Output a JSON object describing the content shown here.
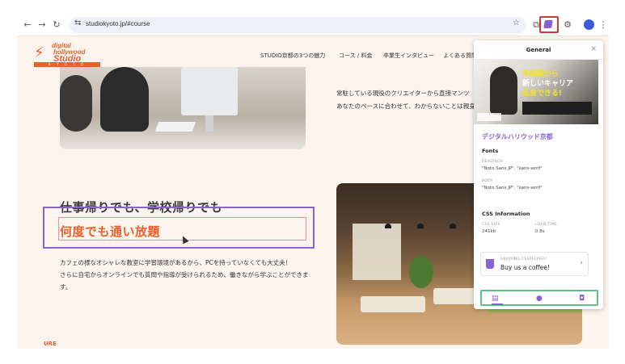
{
  "browser": {
    "back": "←",
    "forward": "→",
    "reload": "↻",
    "tune_icon": "⇆",
    "url": "studiokyoto.jp/#course",
    "star": "☆",
    "extensions": [
      "⧉",
      "▰",
      "⚙"
    ],
    "menu": "⋮",
    "avatar": "👤"
  },
  "site": {
    "logo": {
      "line1": "digital",
      "line2": "hollywood",
      "line3": "Studio",
      "tag": "K Y O T O",
      "mark": "⚡"
    },
    "nav": [
      "STUDIO京都の3つの魅力",
      "コース / 料金",
      "卒業生インタビュー",
      "よくある質問"
    ],
    "para_top": [
      "常駐している現役のクリエイターから直接マンツ",
      "あなたのペースに合わせて、わからないことは親身"
    ],
    "heading1": "仕事帰りでも、学校帰りでも",
    "heading2": "何度でも通い放題",
    "body": [
      "カフェの様なオシャレな教室に学習環境があるから、PCを持っていなくても大丈夫！",
      "さらに自宅からオンラインでも質問や指導が受けられるため、働きながら学ぶことができます。"
    ],
    "bottom_logo": "URE"
  },
  "panel": {
    "title": "General",
    "close": "×",
    "banner": {
      "line1": "未経験から",
      "line2": "新しいキャリア",
      "line3": "転身できる!"
    },
    "site_name": "デジタルハリウッド京都",
    "fonts_title": "Fonts",
    "headings_label": "HEADINGS",
    "headings_value": "\"Noto Sans JP\", \"sans-serif\"",
    "body_label": "BODY",
    "body_value": "\"Noto Sans JP\", \"sans-serif\"",
    "css_title": "CSS Information",
    "css_size_label": "CSS SIZE",
    "css_size_value": "241kb",
    "load_label": "LOAD TIME",
    "load_value": "0.8s",
    "coffee_small": "ENJOYING CSSPEEPER?",
    "coffee_main": "Buy us a coffee!",
    "coffee_chev": "›",
    "tab_icons": [
      "▤",
      "●",
      "◘"
    ]
  }
}
